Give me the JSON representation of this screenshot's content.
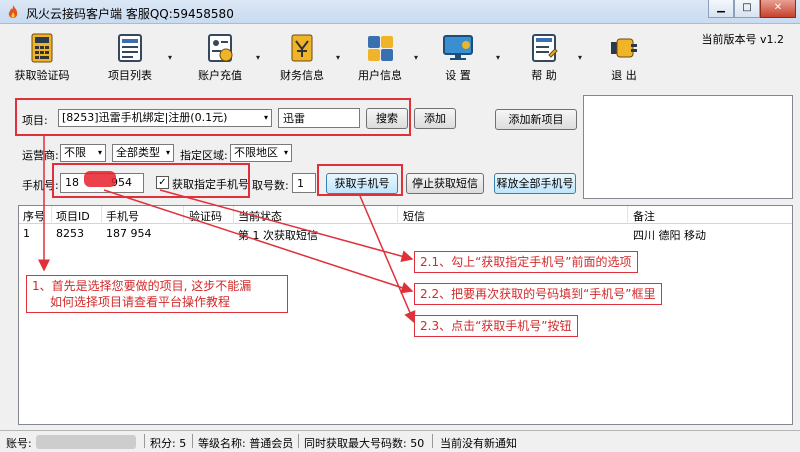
{
  "window": {
    "title": "风火云接码客户端   客服QQ:59458580",
    "controls": {
      "minimize": "▁",
      "maximize": "□",
      "close": "✕"
    }
  },
  "toolbar": {
    "version": "当前版本号 v1.2",
    "items": [
      {
        "label": "获取验证码",
        "icon": "calculator-icon"
      },
      {
        "label": "项目列表",
        "icon": "list-icon"
      },
      {
        "label": "账户充值",
        "icon": "recharge-icon"
      },
      {
        "label": "财务信息",
        "icon": "finance-icon"
      },
      {
        "label": "用户信息",
        "icon": "user-icon"
      },
      {
        "label": "设  置",
        "icon": "monitor-icon"
      },
      {
        "label": "帮  助",
        "icon": "help-icon"
      },
      {
        "label": "退  出",
        "icon": "exit-icon"
      }
    ],
    "dropdown_glyph": "▾"
  },
  "form": {
    "project_label": "项目:",
    "project_value": "[8253]迅雷手机绑定|注册(0.1元)",
    "search_value": "迅雷",
    "search_button": "搜索",
    "add_button": "添加",
    "add_new_button": "添加新项目",
    "operator_label": "运营商:",
    "operator_value": "不限",
    "type_value": "全部类型",
    "region_label": "指定区域:",
    "region_value": "不限地区",
    "phone_label": "手机号:",
    "phone_value": "18   954",
    "phone_prefix": "18",
    "phone_suffix": "954",
    "specify_checkbox": "获取指定手机号",
    "count_label": "取号数:",
    "count_value": "1",
    "get_phone_button": "获取手机号",
    "stop_sms_button": "停止获取短信",
    "release_all_button": "释放全部手机号"
  },
  "table": {
    "columns": [
      "序号",
      "项目ID",
      "手机号",
      "验证码",
      "当前状态",
      "短信",
      "备注"
    ],
    "rows": [
      {
        "index": "1",
        "project_id": "8253",
        "phone": "187    954",
        "code": "",
        "status": "第 1 次获取短信",
        "sms": "",
        "note": "四川 德阳 移动"
      }
    ]
  },
  "annotations": {
    "note1_line1": "1、首先是选择您要做的项目, 这步不能漏",
    "note1_line2": "如何选择项目请查看平台操作教程",
    "note2": "2.1、勾上“获取指定手机号”前面的选项",
    "note3": "2.2、把要再次获取的号码填到“手机号”框里",
    "note4": "2.3、点击“获取手机号”按钮",
    "color": "#e0303a"
  },
  "status": {
    "account_label": "账号:",
    "points": "积分: 5",
    "level": "等级名称: 普通会员",
    "max_phones": "同时获取最大号码数: 50",
    "notice": "当前没有新通知"
  }
}
